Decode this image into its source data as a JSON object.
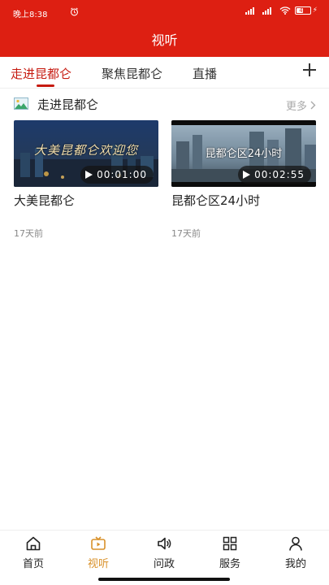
{
  "status_bar": {
    "time": "晚上8:38",
    "battery_level": "49"
  },
  "header": {
    "title": "视听"
  },
  "tabs": [
    {
      "label": "走进昆都仑",
      "active": true
    },
    {
      "label": "聚焦昆都仑",
      "active": false
    },
    {
      "label": "直播",
      "active": false
    }
  ],
  "section": {
    "title": "走进昆都仑",
    "more_label": "更多"
  },
  "videos": [
    {
      "thumb_caption": "大美昆都仑欢迎您",
      "duration": "00:01:00",
      "title": "大美昆都仑",
      "time_ago": "17天前"
    },
    {
      "thumb_caption": "昆都仑区24小时",
      "duration": "00:02:55",
      "title": "昆都仑区24小时",
      "time_ago": "17天前"
    }
  ],
  "bottom_nav": [
    {
      "label": "首页",
      "icon": "home-icon",
      "active": false
    },
    {
      "label": "视听",
      "icon": "video-tv-icon",
      "active": true
    },
    {
      "label": "问政",
      "icon": "speaker-icon",
      "active": false
    },
    {
      "label": "服务",
      "icon": "grid-icon",
      "active": false
    },
    {
      "label": "我的",
      "icon": "user-icon",
      "active": false
    }
  ],
  "colors": {
    "brand_red": "#dd1f12",
    "tab_active": "#c61a10",
    "nav_active": "#d9912a"
  }
}
